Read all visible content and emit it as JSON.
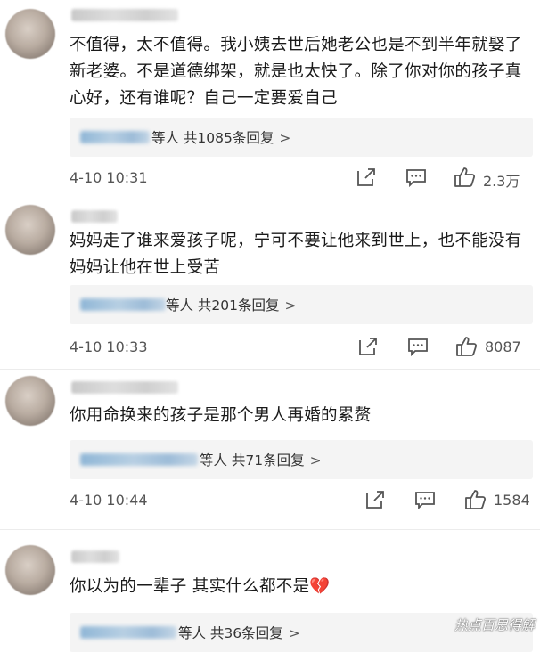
{
  "comments": [
    {
      "text": "不值得，太不值得。我小姨去世后她老公也是不到半年就娶了新老婆。不是道德绑架，就是也太快了。除了你对你的孩子真心好，还有谁呢？自己一定要爱自己",
      "reply_label": "等人 共1085条回复",
      "time": "4-10 10:31",
      "likes": "2.3万"
    },
    {
      "text": "妈妈走了谁来爱孩子呢，宁可不要让他来到世上，也不能没有妈妈让他在世上受苦",
      "reply_label": "等人 共201条回复",
      "time": "4-10 10:33",
      "likes": "8087"
    },
    {
      "text": "你用命换来的孩子是那个男人再婚的累赘",
      "reply_label": "等人 共71条回复",
      "time": "4-10 10:44",
      "likes": "1584"
    },
    {
      "text": "你以为的一辈子 其实什么都不是",
      "emoji": "💔",
      "reply_label": "等人 共36条回复"
    }
  ],
  "reply_chevron": ">",
  "icons": {
    "share": "share-icon",
    "comment": "comment-icon",
    "like": "thumbs-up-icon",
    "emoji": "broken-heart-emoji"
  },
  "watermark": "热点百思得解",
  "colors": {
    "text": "#1a1a1a",
    "meta": "#555555",
    "reply_bg": "#f4f4f4",
    "divider": "#ececec"
  }
}
